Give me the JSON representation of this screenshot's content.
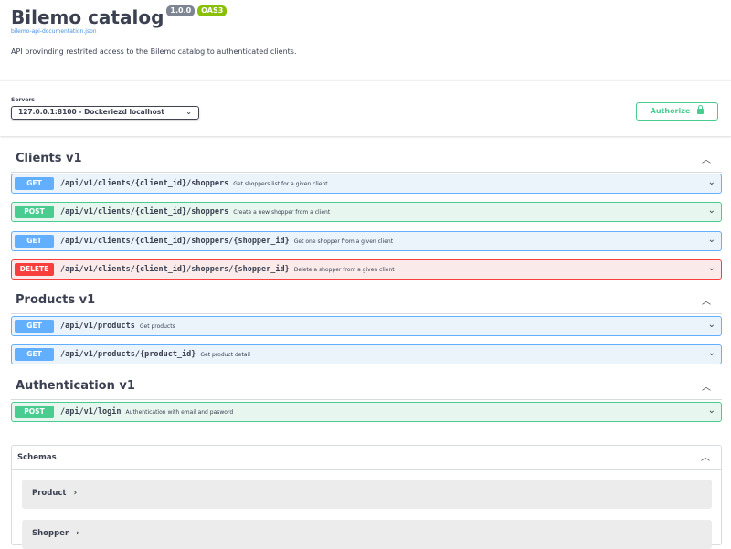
{
  "info": {
    "title": "Bilemo catalog",
    "version": "1.0.0",
    "oas_badge": "OAS3",
    "doc_link": "bilemo-api-documentation.json",
    "description": "API provinding restrited access to the Bilemo catalog to authenticated clients."
  },
  "servers": {
    "label": "Servers",
    "selected": "127.0.0.1:8100 - Dockeriezd localhost"
  },
  "authorize_label": "Authorize",
  "sections": [
    {
      "name": "Clients v1",
      "operations": [
        {
          "method": "GET",
          "path": "/api/v1/clients/{client_id}/shoppers",
          "summary": "Get shoppers list for a given client"
        },
        {
          "method": "POST",
          "path": "/api/v1/clients/{client_id}/shoppers",
          "summary": "Create a new shopper from a client"
        },
        {
          "method": "GET",
          "path": "/api/v1/clients/{client_id}/shoppers/{shopper_id}",
          "summary": "Get one shopper from a given client"
        },
        {
          "method": "DELETE",
          "path": "/api/v1/clients/{client_id}/shoppers/{shopper_id}",
          "summary": "Delete a shopper from a given client"
        }
      ]
    },
    {
      "name": "Products v1",
      "operations": [
        {
          "method": "GET",
          "path": "/api/v1/products",
          "summary": "Get products"
        },
        {
          "method": "GET",
          "path": "/api/v1/products/{product_id}",
          "summary": "Get product detail"
        }
      ]
    },
    {
      "name": "Authentication v1",
      "operations": [
        {
          "method": "POST",
          "path": "/api/v1/login",
          "summary": "Authentication with email and pasword"
        }
      ]
    }
  ],
  "schemas": {
    "title": "Schemas",
    "items": [
      "Product",
      "Shopper"
    ]
  },
  "colors": {
    "get": "#61affe",
    "post": "#49cc90",
    "delete": "#f93e3e",
    "text": "#3b4151"
  },
  "icons": {
    "collapse": "chevron-up-icon",
    "expand": "chevron-down-icon",
    "authorize": "lock-icon"
  }
}
